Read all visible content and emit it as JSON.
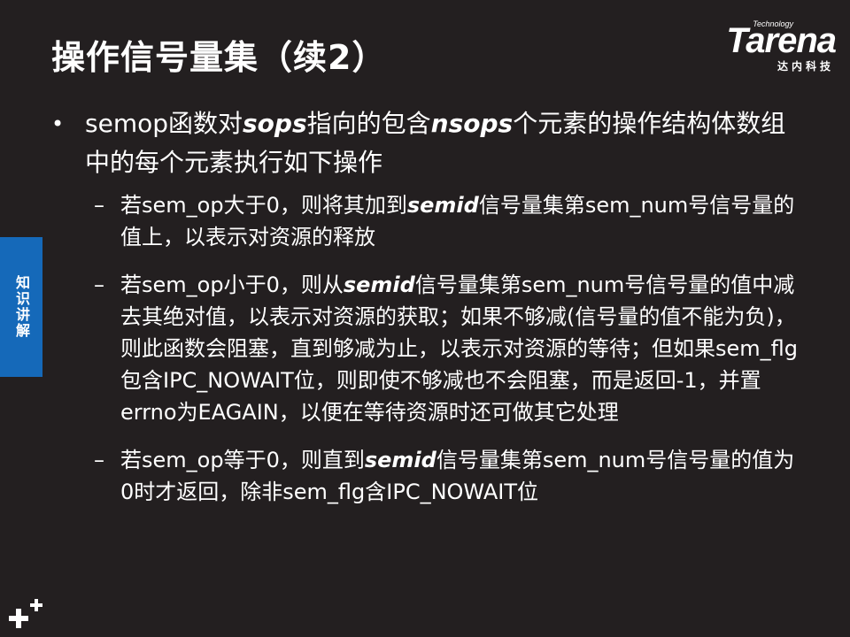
{
  "title": "操作信号量集（续2）",
  "logo": {
    "small": "Technology",
    "brand": "Tarena",
    "cn": "达内科技"
  },
  "side_tab": {
    "label": "知识讲解"
  },
  "bullet": {
    "p1": "semop函数对",
    "e1": "sops",
    "p2": "指向的包含",
    "e2": "nsops",
    "p3": "个元素的操作结构体数组中的每个元素执行如下操作"
  },
  "sub1": {
    "p1": "若sem_op大于0，则将其加到",
    "e1": "semid",
    "p2": "信号量集第sem_num号信号量的值上，以表示对资源的释放"
  },
  "sub2": {
    "p1": "若sem_op小于0，则从",
    "e1": "semid",
    "p2": "信号量集第sem_num号信号量的值中减去其绝对值，以表示对资源的获取；如果不够减(信号量的值不能为负)，则此函数会阻塞，直到够减为止，以表示对资源的等待；但如果sem_flg包含IPC_NOWAIT位，则即使不够减也不会阻塞，而是返回-1，并置errno为EAGAIN，以便在等待资源时还可做其它处理"
  },
  "sub3": {
    "p1": "若sem_op等于0，则直到",
    "e1": "semid",
    "p2": "信号量集第sem_num号信号量的值为0时才返回，除非sem_flg含IPC_NOWAIT位"
  },
  "colors": {
    "background": "#231f20",
    "text": "#ffffff",
    "tab": "#1569b9"
  }
}
